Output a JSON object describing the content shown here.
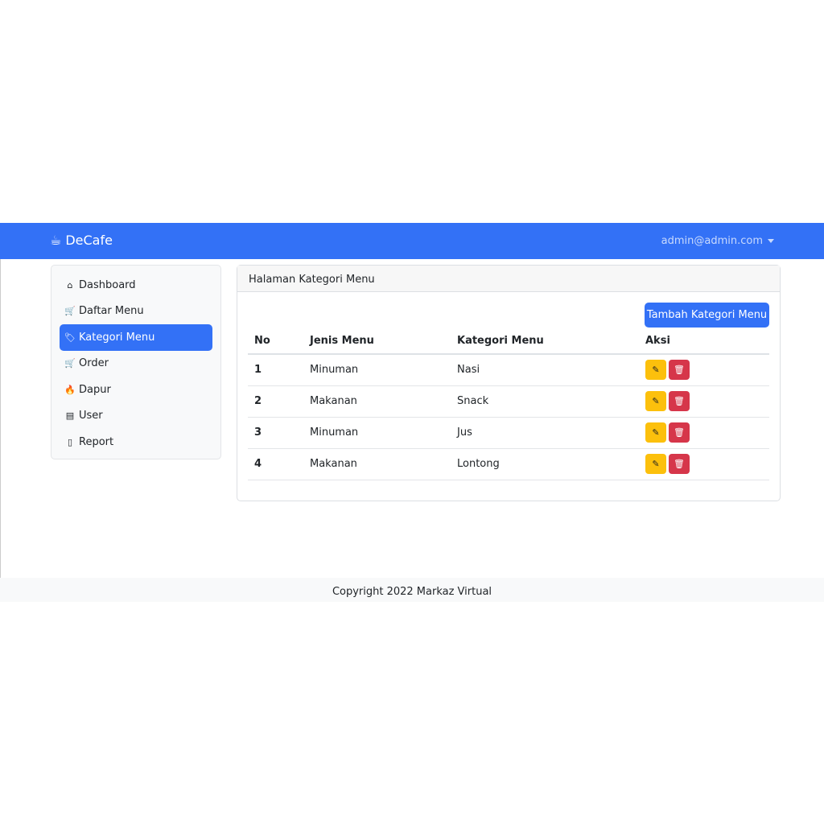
{
  "navbar": {
    "brand": "DeCafe",
    "user": "admin@admin.com"
  },
  "sidebar": {
    "items": [
      {
        "label": "Dashboard",
        "icon": "house-icon"
      },
      {
        "label": "Daftar Menu",
        "icon": "cart-icon"
      },
      {
        "label": "Kategori Menu",
        "icon": "tag-icon",
        "active": true
      },
      {
        "label": "Order",
        "icon": "cart-icon"
      },
      {
        "label": "Dapur",
        "icon": "fire-icon"
      },
      {
        "label": "User",
        "icon": "card-list-icon"
      },
      {
        "label": "Report",
        "icon": "report-icon"
      }
    ]
  },
  "main": {
    "title": "Halaman Kategori Menu",
    "add_button": "Tambah Kategori Menu",
    "columns": [
      "No",
      "Jenis Menu",
      "Kategori Menu",
      "Aksi"
    ],
    "rows": [
      [
        "1",
        "Minuman",
        "Nasi"
      ],
      [
        "2",
        "Makanan",
        "Snack"
      ],
      [
        "3",
        "Minuman",
        "Jus"
      ],
      [
        "4",
        "Makanan",
        "Lontong"
      ]
    ]
  },
  "footer": "Copyright 2022 Markaz Virtual"
}
